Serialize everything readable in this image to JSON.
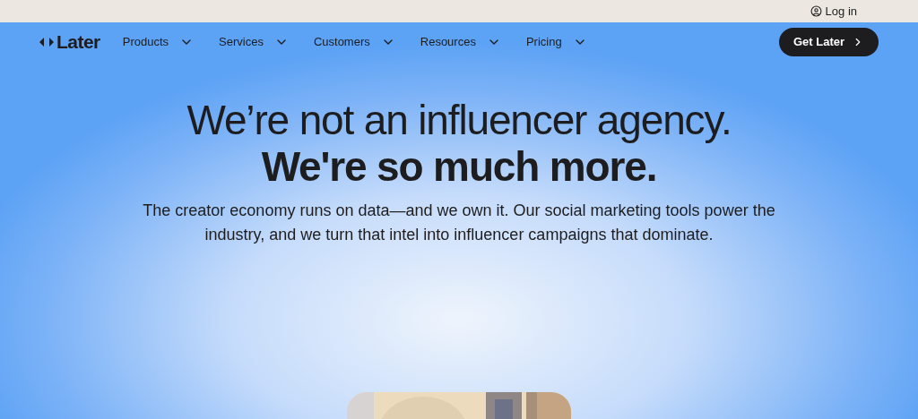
{
  "top_bar": {
    "login": "Log in"
  },
  "nav": {
    "logo": "Later",
    "items": [
      {
        "label": "Products"
      },
      {
        "label": "Services"
      },
      {
        "label": "Customers"
      },
      {
        "label": "Resources"
      },
      {
        "label": "Pricing"
      }
    ],
    "cta": "Get Later"
  },
  "hero": {
    "title_line_1": "We’re not an influencer agency.",
    "title_line_2": "We're so much more.",
    "subtitle": "The creator economy runs on data—and we own it. Our social marketing tools power the industry, and we turn that intel into influencer campaigns that dominate."
  }
}
